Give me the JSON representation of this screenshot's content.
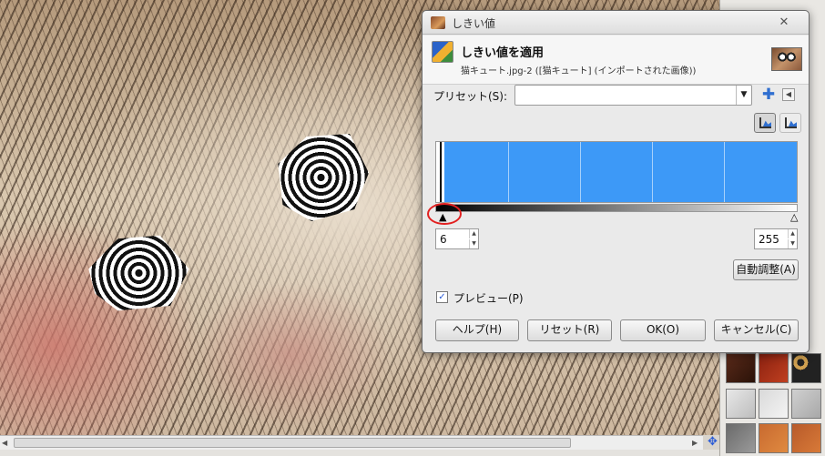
{
  "dialog": {
    "title": "しきい値",
    "header_title": "しきい値を適用",
    "header_subtitle": "猫キュート.jpg-2 ([猫キュート] (インポートされた画像))",
    "preset_label": "プリセット(S):",
    "preset_value": "",
    "low_handle_glyph": "▲",
    "high_handle_glyph": "△",
    "low_value": "6",
    "high_value": "255",
    "auto_button": "自動調整(A)",
    "preview_checked": "✓",
    "preview_label": "プレビュー(P)",
    "help_button": "ヘルプ(H)",
    "reset_button": "リセット(R)",
    "ok_button": "OK(O)",
    "cancel_button": "キャンセル(C)"
  },
  "icons": {
    "close": "✕",
    "dropdown": "▼",
    "add": "✚",
    "menu": "◀",
    "spin_up": "▲",
    "spin_down": "▼",
    "scroll_left": "◀",
    "scroll_right": "▶",
    "navigate": "✥"
  },
  "colors": {
    "histogram": "#3d99f7",
    "annotation": "#e22020"
  }
}
